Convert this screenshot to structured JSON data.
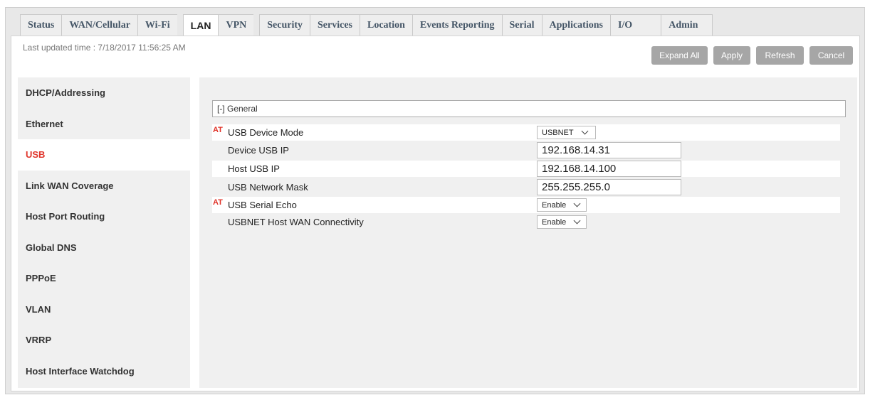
{
  "tabs": [
    {
      "label": "Status"
    },
    {
      "label": "WAN/Cellular"
    },
    {
      "label": "Wi-Fi"
    },
    {
      "label": "LAN"
    },
    {
      "label": "VPN"
    },
    {
      "label": "Security"
    },
    {
      "label": "Services"
    },
    {
      "label": "Location"
    },
    {
      "label": "Events Reporting"
    },
    {
      "label": "Serial"
    },
    {
      "label": "Applications"
    },
    {
      "label": "I/O"
    },
    {
      "label": "Admin"
    }
  ],
  "header": {
    "last_updated": "Last updated time : 7/18/2017 11:56:25 AM"
  },
  "actions": {
    "expand_all": "Expand All",
    "apply": "Apply",
    "refresh": "Refresh",
    "cancel": "Cancel"
  },
  "sidebar": {
    "items": [
      {
        "label": "DHCP/Addressing"
      },
      {
        "label": "Ethernet"
      },
      {
        "label": "USB"
      },
      {
        "label": "Link WAN Coverage"
      },
      {
        "label": "Host Port Routing"
      },
      {
        "label": "Global DNS"
      },
      {
        "label": "PPPoE"
      },
      {
        "label": "VLAN"
      },
      {
        "label": "VRRP"
      },
      {
        "label": "Host Interface Watchdog"
      }
    ]
  },
  "section": {
    "title": "[-] General"
  },
  "fields": {
    "at_marker": "AT",
    "usb_device_mode": {
      "label": "USB Device Mode",
      "value": "USBNET"
    },
    "device_usb_ip": {
      "label": "Device USB IP",
      "value": "192.168.14.31"
    },
    "host_usb_ip": {
      "label": "Host USB IP",
      "value": "192.168.14.100"
    },
    "usb_network_mask": {
      "label": "USB Network Mask",
      "value": "255.255.255.0"
    },
    "usb_serial_echo": {
      "label": "USB Serial Echo",
      "value": "Enable"
    },
    "usbnet_host_wan": {
      "label": "USBNET Host WAN Connectivity",
      "value": "Enable"
    }
  },
  "colors": {
    "accent_red": "#e0352b",
    "button_gray": "#a6a6a6"
  }
}
